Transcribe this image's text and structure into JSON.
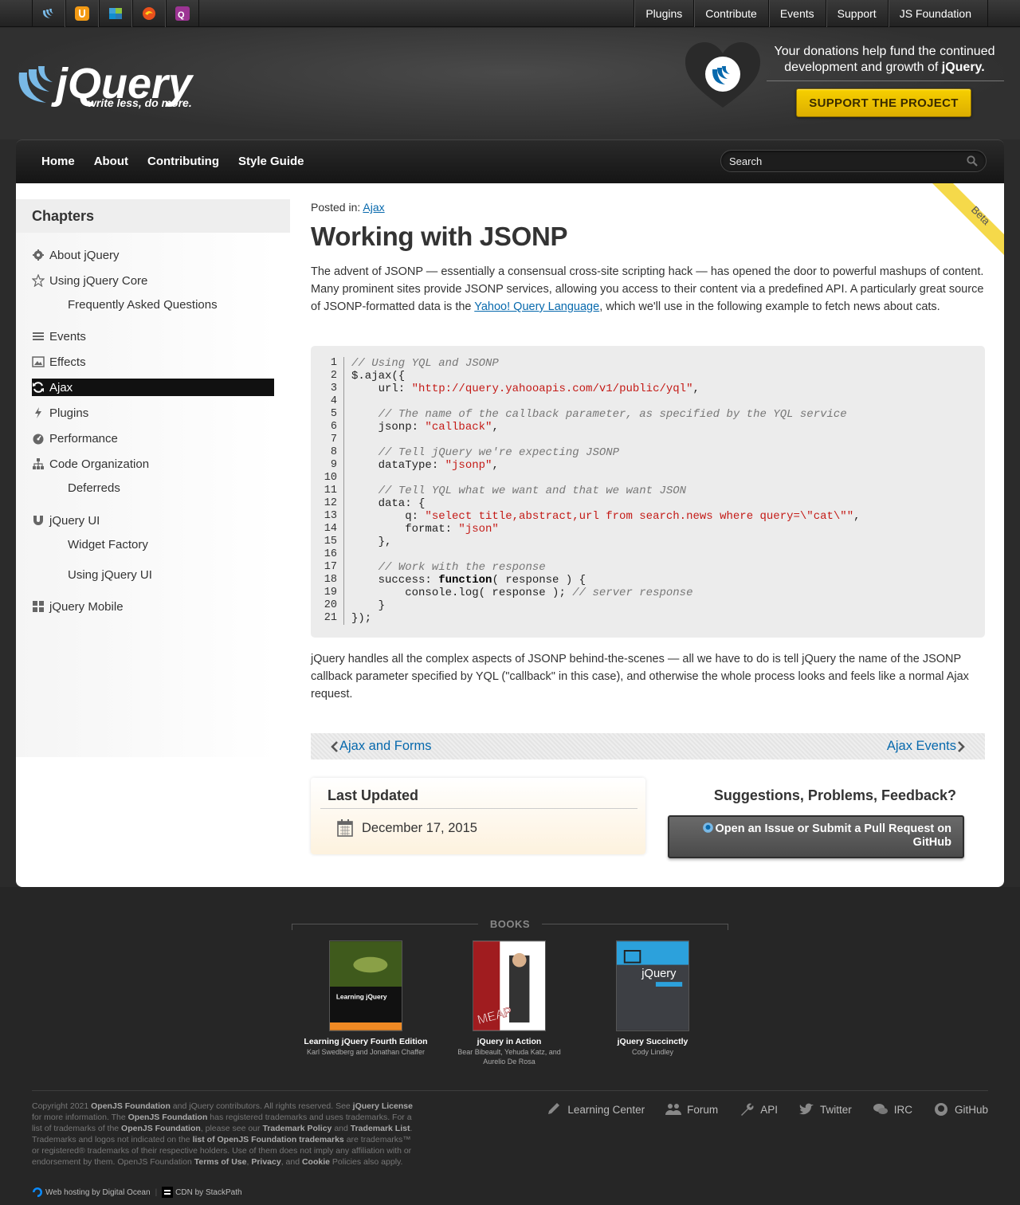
{
  "topbar": {
    "projects": [
      "jquery-icon",
      "jquery-ui-icon",
      "jquery-mobile-icon",
      "sizzle-icon",
      "qunit-icon"
    ],
    "nav": [
      "Plugins",
      "Contribute",
      "Events",
      "Support",
      "JS Foundation"
    ]
  },
  "header": {
    "logo_text": "jQuery",
    "tagline": "write less, do more.",
    "donate_line1": "Your donations help fund the continued",
    "donate_line2": "development and growth of",
    "donate_brand": "jQuery.",
    "support_button": "SUPPORT THE PROJECT"
  },
  "mainnav": {
    "links": [
      "Home",
      "About",
      "Contributing",
      "Style Guide"
    ],
    "search_placeholder": "Search"
  },
  "sidebar": {
    "heading": "Chapters",
    "chapters": [
      {
        "label": "About jQuery",
        "icon": "gear-icon"
      },
      {
        "label": "Using jQuery Core",
        "icon": "star-icon"
      },
      {
        "label": "Frequently Asked Questions",
        "icon": ""
      },
      {
        "label": "Events",
        "icon": "list-icon"
      },
      {
        "label": "Effects",
        "icon": "picture-icon"
      },
      {
        "label": "Ajax",
        "icon": "refresh-icon"
      },
      {
        "label": "Plugins",
        "icon": "bolt-icon"
      },
      {
        "label": "Performance",
        "icon": "dashboard-icon"
      },
      {
        "label": "Code Organization",
        "icon": "sitemap-icon"
      },
      {
        "label": "Deferreds",
        "icon": ""
      },
      {
        "label": "jQuery UI",
        "icon": "magnet-icon"
      },
      {
        "label": "Widget Factory",
        "icon": ""
      },
      {
        "label": "Using jQuery UI",
        "icon": ""
      },
      {
        "label": "jQuery Mobile",
        "icon": "grid-icon"
      }
    ]
  },
  "article": {
    "posted_label": "Posted in:",
    "posted_link": "Ajax",
    "title": "Working with JSONP",
    "beta": "Beta",
    "intro_1": "The advent of JSONP — essentially a consensual cross-site scripting hack — has opened the door to powerful mashups of content. Many prominent sites provide JSONP services, allowing you access to their content via a predefined API. A particularly great source of JSONP-formatted data is the ",
    "intro_link": "Yahoo! Query Language",
    "intro_2": ", which we'll use in the following example to fetch news about cats.",
    "code_lines": [
      [
        [
          "c",
          "// Using YQL and JSONP"
        ]
      ],
      [
        [
          "p",
          "$.ajax({"
        ]
      ],
      [
        [
          "p",
          "    url: "
        ],
        [
          "s",
          "\"http://query.yahooapis.com/v1/public/yql\""
        ],
        [
          "p",
          ","
        ]
      ],
      [
        [
          "p",
          ""
        ]
      ],
      [
        [
          "p",
          "    "
        ],
        [
          "c",
          "// The name of the callback parameter, as specified by the YQL service"
        ]
      ],
      [
        [
          "p",
          "    jsonp: "
        ],
        [
          "s",
          "\"callback\""
        ],
        [
          "p",
          ","
        ]
      ],
      [
        [
          "p",
          ""
        ]
      ],
      [
        [
          "p",
          "    "
        ],
        [
          "c",
          "// Tell jQuery we're expecting JSONP"
        ]
      ],
      [
        [
          "p",
          "    dataType: "
        ],
        [
          "s",
          "\"jsonp\""
        ],
        [
          "p",
          ","
        ]
      ],
      [
        [
          "p",
          ""
        ]
      ],
      [
        [
          "p",
          "    "
        ],
        [
          "c",
          "// Tell YQL what we want and that we want JSON"
        ]
      ],
      [
        [
          "p",
          "    data: {"
        ]
      ],
      [
        [
          "p",
          "        q: "
        ],
        [
          "s",
          "\"select title,abstract,url from search.news where query=\\\"cat\\\"\""
        ],
        [
          "p",
          ","
        ]
      ],
      [
        [
          "p",
          "        format: "
        ],
        [
          "s",
          "\"json\""
        ]
      ],
      [
        [
          "p",
          "    },"
        ]
      ],
      [
        [
          "p",
          ""
        ]
      ],
      [
        [
          "p",
          "    "
        ],
        [
          "c",
          "// Work with the response"
        ]
      ],
      [
        [
          "p",
          "    success: "
        ],
        [
          "k",
          "function"
        ],
        [
          "p",
          "( response ) {"
        ]
      ],
      [
        [
          "p",
          "        console.log( response ); "
        ],
        [
          "c",
          "// server response"
        ]
      ],
      [
        [
          "p",
          "    }"
        ]
      ],
      [
        [
          "p",
          "});"
        ]
      ]
    ],
    "outro": "jQuery handles all the complex aspects of JSONP behind-the-scenes — all we have to do is tell jQuery the name of the JSONP callback parameter specified by YQL (\"callback\" in this case), and otherwise the whole process looks and feels like a normal Ajax request.",
    "prev": "Ajax and Forms",
    "next": "Ajax Events",
    "updated_heading": "Last Updated",
    "updated_date": "December 17, 2015",
    "feedback_heading": "Suggestions, Problems, Feedback?",
    "issue_line1": "Open an Issue or Submit a Pull Request on",
    "issue_line2": "GitHub"
  },
  "footer": {
    "books_heading": "BOOKS",
    "books": [
      {
        "title": "Learning jQuery Fourth Edition",
        "authors": "Karl Swedberg and Jonathan Chaffer",
        "cover_text": "Learning jQuery"
      },
      {
        "title": "jQuery in Action",
        "authors": "Bear Bibeault, Yehuda Katz, and Aurelio De Rosa",
        "cover_text": "MEAP"
      },
      {
        "title": "jQuery Succinctly",
        "authors": "Cody Lindley",
        "cover_text": "jQuery"
      }
    ],
    "copyright": [
      [
        "n",
        "Copyright 2021 "
      ],
      [
        "b",
        "OpenJS Foundation"
      ],
      [
        "n",
        " and jQuery contributors. All rights reserved. See "
      ],
      [
        "b",
        "jQuery License"
      ],
      [
        "n",
        " for more information. The "
      ],
      [
        "b",
        "OpenJS Foundation"
      ],
      [
        "n",
        " has registered trademarks and uses trademarks. For a list of trademarks of the "
      ],
      [
        "b",
        "OpenJS Foundation"
      ],
      [
        "n",
        ", please see our "
      ],
      [
        "b",
        "Trademark Policy"
      ],
      [
        "n",
        " and "
      ],
      [
        "b",
        "Trademark List"
      ],
      [
        "n",
        ". Trademarks and logos not indicated on the "
      ],
      [
        "b",
        "list of OpenJS Foundation trademarks"
      ],
      [
        "n",
        " are trademarks™ or registered® trademarks of their respective holders. Use of them does not imply any affiliation with or endorsement by them. OpenJS Foundation "
      ],
      [
        "b",
        "Terms of Use"
      ],
      [
        "n",
        ", "
      ],
      [
        "b",
        "Privacy"
      ],
      [
        "n",
        ", and "
      ],
      [
        "b",
        "Cookie"
      ],
      [
        "n",
        " Policies also apply."
      ]
    ],
    "hosting_1": "Web hosting by Digital Ocean",
    "hosting_sep": "|",
    "hosting_2": "CDN by StackPath",
    "links": [
      {
        "label": "Learning Center",
        "icon": "pencil-icon"
      },
      {
        "label": "Forum",
        "icon": "users-icon"
      },
      {
        "label": "API",
        "icon": "wrench-icon"
      },
      {
        "label": "Twitter",
        "icon": "twitter-icon"
      },
      {
        "label": "IRC",
        "icon": "chat-icon"
      },
      {
        "label": "GitHub",
        "icon": "github-icon"
      }
    ]
  },
  "colors": {
    "link": "#0769ad",
    "support_button": "#f7d000",
    "code_background": "#ececec",
    "string": "#c41a16",
    "comment": "#777777"
  }
}
